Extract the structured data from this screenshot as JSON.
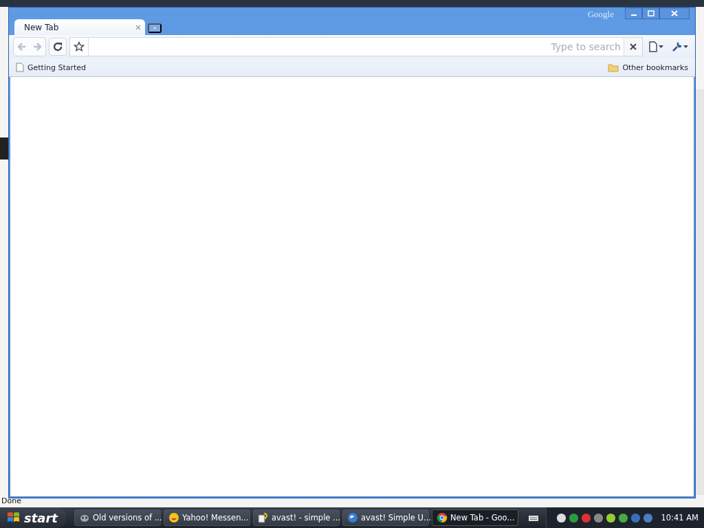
{
  "background_window": {
    "status": "Done"
  },
  "browser": {
    "brand": "Google",
    "tabs": [
      {
        "label": "New Tab",
        "selected": true
      }
    ],
    "nav": [
      {
        "kind": "back",
        "disabled": true
      },
      {
        "kind": "forward",
        "disabled": true
      }
    ],
    "omnibox": {
      "placeholder": "Type to search"
    },
    "bookmarks": [
      {
        "label": "Getting Started"
      }
    ],
    "other_bookmarks": "Other bookmarks"
  },
  "taskbar": {
    "start": "start",
    "tasks": [
      {
        "label": "Old versions of ...",
        "kind": "app",
        "selected": false
      },
      {
        "label": "Yahoo! Messen...",
        "kind": "smiley",
        "selected": false
      },
      {
        "label": "avast! - simple ...",
        "kind": "help",
        "selected": false
      },
      {
        "label": "avast! Simple U...",
        "kind": "globe",
        "selected": false
      },
      {
        "label": "New Tab - Goo...",
        "kind": "browser",
        "selected": true
      }
    ],
    "clock": "10:41 AM"
  }
}
